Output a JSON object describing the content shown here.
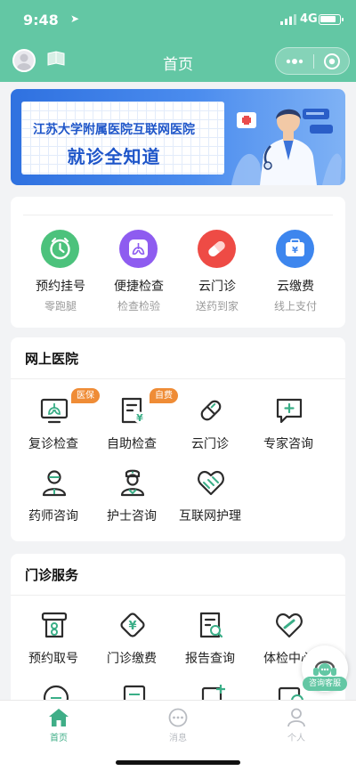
{
  "status_bar": {
    "time": "9:48",
    "network": "4G"
  },
  "header": {
    "title": "首页"
  },
  "banner": {
    "line1": "江苏大学附属医院互联网医院",
    "line2": "就诊全知道"
  },
  "quick_actions": [
    {
      "label": "预约挂号",
      "sub": "零跑腿",
      "icon": "clock-icon",
      "color": "#4cc27c"
    },
    {
      "label": "便捷检查",
      "sub": "检查检验",
      "icon": "lungs-icon",
      "color": "#8e5cf0"
    },
    {
      "label": "云门诊",
      "sub": "送药到家",
      "icon": "pill-icon",
      "color": "#ee4b45"
    },
    {
      "label": "云缴费",
      "sub": "线上支付",
      "icon": "wallet-icon",
      "color": "#3d86ee"
    }
  ],
  "online_hospital": {
    "title": "网上医院",
    "items": [
      {
        "label": "复诊检查",
        "tag": "医保"
      },
      {
        "label": "自助检查",
        "tag": "自费"
      },
      {
        "label": "云门诊"
      },
      {
        "label": "专家咨询"
      },
      {
        "label": "药师咨询"
      },
      {
        "label": "护士咨询"
      },
      {
        "label": "互联网护理"
      }
    ]
  },
  "outpatient": {
    "title": "门诊服务",
    "items": [
      {
        "label": "预约取号"
      },
      {
        "label": "门诊缴费"
      },
      {
        "label": "报告查询"
      },
      {
        "label": "体检中心"
      }
    ]
  },
  "customer_service": {
    "label": "咨询客服"
  },
  "tabbar": [
    {
      "label": "首页",
      "active": true
    },
    {
      "label": "消息"
    },
    {
      "label": "个人"
    }
  ],
  "colors": {
    "brand": "#63c7a4",
    "tab_active": "#3fae87",
    "tab_inactive": "#b9bcc2",
    "tag": "#ef8c36"
  }
}
